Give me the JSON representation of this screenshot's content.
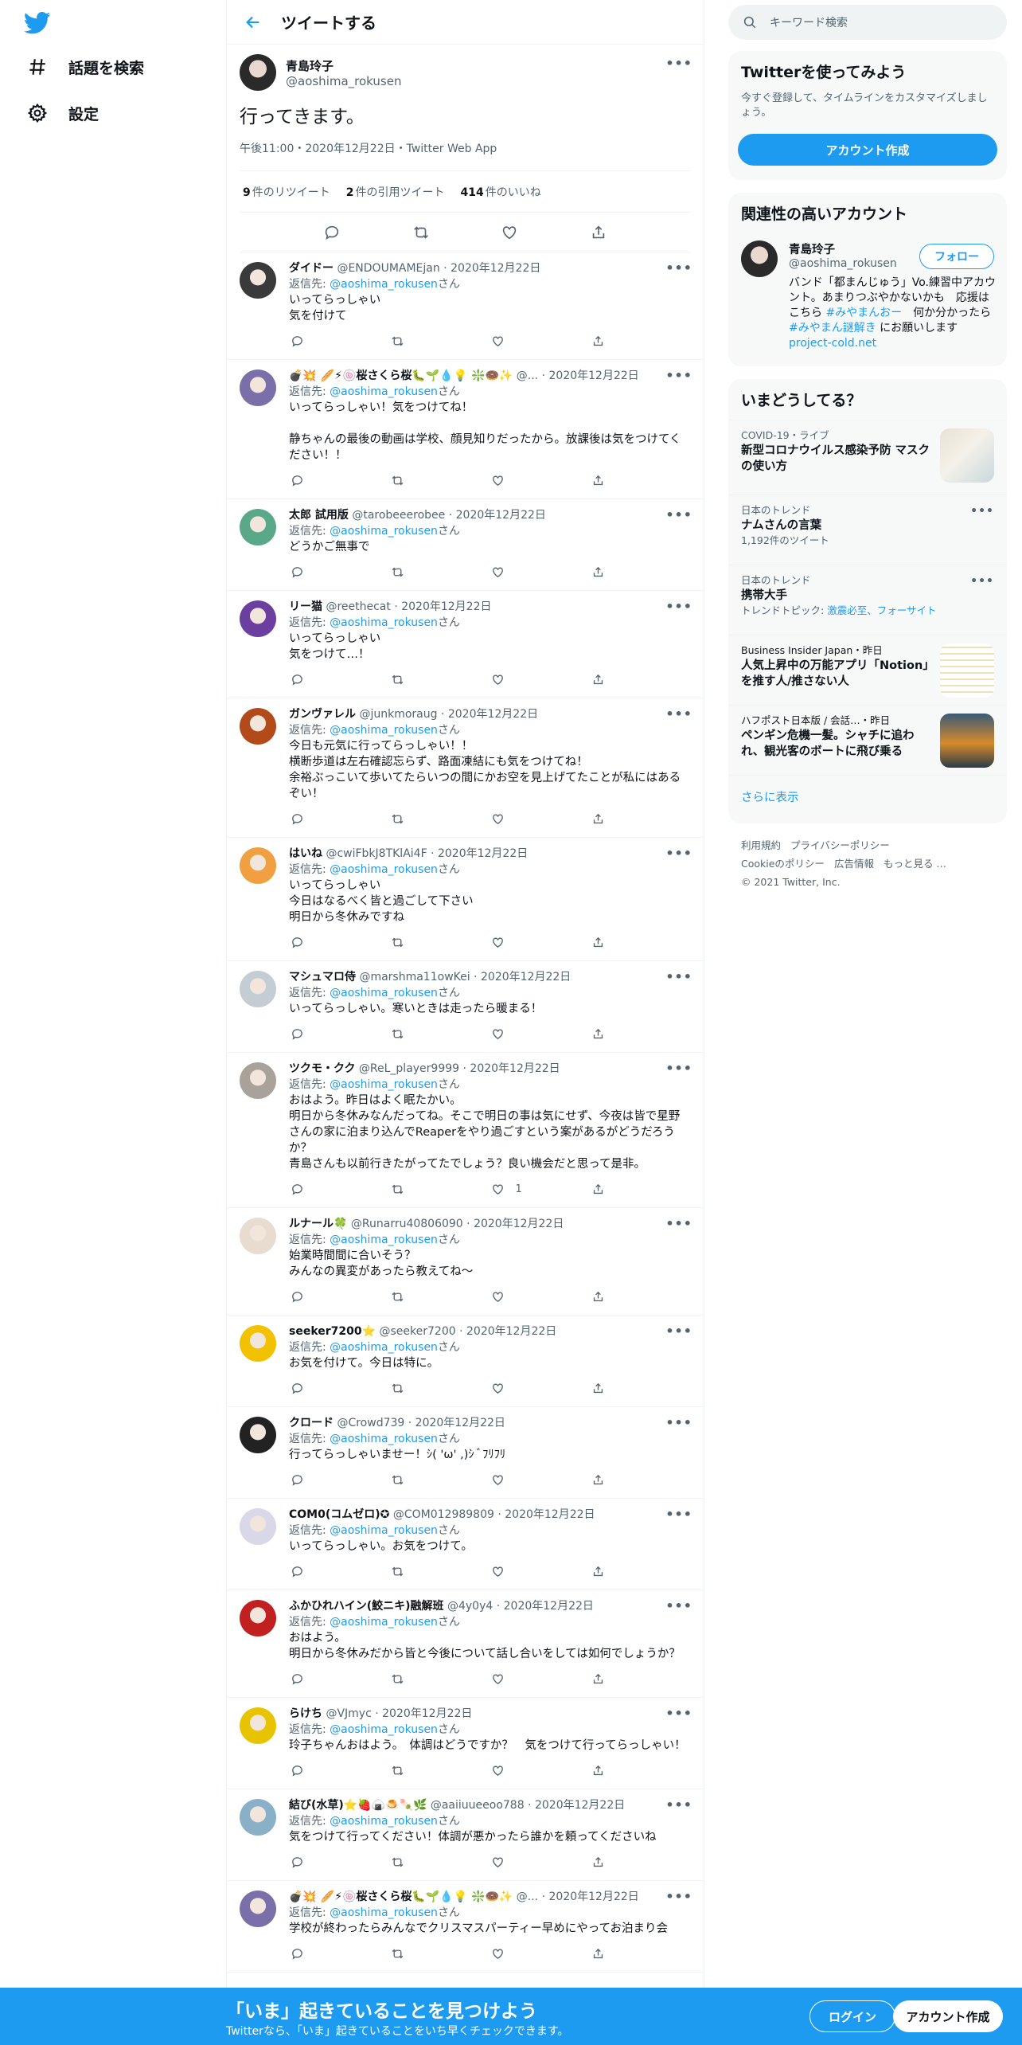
{
  "nav": {
    "items": [
      {
        "label": "話題を検索",
        "icon": "hashtag-icon"
      },
      {
        "label": "設定",
        "icon": "gear-icon"
      }
    ]
  },
  "header": {
    "title": "ツイートする"
  },
  "tweet": {
    "name": "青島玲子",
    "handle": "@aoshima_rokusen",
    "text": "行ってきます。",
    "meta": "午後11:00・2020年12月22日・Twitter Web App",
    "retweets": "9",
    "retweets_label": "件のリツイート",
    "quotes": "2",
    "quotes_label": "件の引用ツイート",
    "likes": "414",
    "likes_label": "件のいいね"
  },
  "reply_prefix": "返信先: ",
  "reply_suffix": "さん",
  "replies": [
    {
      "name": "ダイドー",
      "handle": "@ENDOUMAMEjan",
      "date": "2020年12月22日",
      "to": "@aoshima_rokusen",
      "text": "いってらっしゃい\n気を付けて",
      "likes": "",
      "avatar": "#3a3a3a"
    },
    {
      "name": "💣💥 🥖⚡🍥桜さくら桜🐛🌱💧💡 ❇️🍩✨",
      "handle": "@...",
      "date": "2020年12月22日",
      "to": "@aoshima_rokusen",
      "text": "いってらっしゃい！気をつけてね！\n\n静ちゃんの最後の動画は学校、顔見知りだったから。放課後は気をつけてください！！",
      "likes": "",
      "avatar": "#7a6fa8"
    },
    {
      "name": "太郎 試用版",
      "handle": "@tarobeeerobee",
      "date": "2020年12月22日",
      "to": "@aoshima_rokusen",
      "text": "どうかご無事で",
      "likes": "",
      "avatar": "#5aa88a"
    },
    {
      "name": "リー猫",
      "handle": "@reethecat",
      "date": "2020年12月22日",
      "to": "@aoshima_rokusen",
      "text": "いってらっしゃい\n気をつけて…！",
      "likes": "",
      "avatar": "#6b3fa0"
    },
    {
      "name": "ガンヴァレル",
      "handle": "@junkmoraug",
      "date": "2020年12月22日",
      "to": "@aoshima_rokusen",
      "text": "今日も元気に行ってらっしゃい！！\n横断歩道は左右確認忘らず、路面凍結にも気をつけてね！\n余裕ぶっこいて歩いてたらいつの間にかお空を見上げてたことが私にはあるぞい！",
      "likes": "",
      "avatar": "#b34a1a"
    },
    {
      "name": "はいね",
      "handle": "@cwiFbkJ8TKlAi4F",
      "date": "2020年12月22日",
      "to": "@aoshima_rokusen",
      "text": "いってらっしゃい\n今日はなるべく皆と過ごして下さい\n明日から冬休みですね",
      "likes": "",
      "avatar": "#f0a040"
    },
    {
      "name": "マシュマロ侍",
      "handle": "@marshma11owKei",
      "date": "2020年12月22日",
      "to": "@aoshima_rokusen",
      "text": "いってらっしゃい。寒いときは走ったら暖まる！",
      "likes": "",
      "avatar": "#c4ccd4"
    },
    {
      "name": "ツクモ・クク",
      "handle": "@ReL_player9999",
      "date": "2020年12月22日",
      "to": "@aoshima_rokusen",
      "text": "おはよう。昨日はよく眠たかい。\n明日から冬休みなんだってね。そこで明日の事は気にせず、今夜は皆で星野さんの家に泊まり込んでReaperをやり過ごすという案があるがどうだろうか？\n青島さんも以前行きたがってたでしょう？良い機会だと思って是非。",
      "likes": "1",
      "avatar": "#a8a29a"
    },
    {
      "name": "ルナール🍀",
      "handle": "@Runarru40806090",
      "date": "2020年12月22日",
      "to": "@aoshima_rokusen",
      "text": "始業時間間に合いそう？\nみんなの異変があったら教えてね〜",
      "likes": "",
      "avatar": "#e8dcd0"
    },
    {
      "name": "seeker7200⭐",
      "handle": "@seeker7200",
      "date": "2020年12月22日",
      "to": "@aoshima_rokusen",
      "text": "お気を付けて。今日は特に。",
      "likes": "",
      "avatar": "#f2c200"
    },
    {
      "name": "クロード",
      "handle": "@Crowd739",
      "date": "2020年12月22日",
      "to": "@aoshima_rokusen",
      "text": "行ってらっしゃいませー！ｼ( 'ω' ,)ｼ ﾞﾌﾘﾌﾘ",
      "likes": "",
      "avatar": "#222222"
    },
    {
      "name": "COM0(コムゼロ)✪",
      "handle": "@COM012989809",
      "date": "2020年12月22日",
      "to": "@aoshima_rokusen",
      "text": "いってらっしゃい。お気をつけて。",
      "likes": "",
      "avatar": "#d8d8e8"
    },
    {
      "name": "ふかひれハイン(鮫ニキ)融解班",
      "handle": "@4y0y4",
      "date": "2020年12月22日",
      "to": "@aoshima_rokusen",
      "text": "おはよう。\n明日から冬休みだから皆と今後について話し合いをしては如何でしょうか？",
      "likes": "",
      "avatar": "#c02020"
    },
    {
      "name": "らけち",
      "handle": "@VJmyc",
      "date": "2020年12月22日",
      "to": "@aoshima_rokusen",
      "text": "玲子ちゃんおはよう。　体調はどうですか？　気をつけて行ってらっしゃい！",
      "likes": "",
      "avatar": "#e8c400"
    },
    {
      "name": "結び(水草)⭐🍓🍙🍮🍡🌿",
      "handle": "@aaiiuueeoo788",
      "date": "2020年12月22日",
      "to": "@aoshima_rokusen",
      "text": "気をつけて行ってください！体調が悪かったら誰かを頼ってくださいね",
      "likes": "",
      "avatar": "#8ab0c8"
    },
    {
      "name": "💣💥 🥖⚡🍥桜さくら桜🐛🌱💧💡 ❇️🍩✨",
      "handle": "@...",
      "date": "2020年12月22日",
      "to": "@aoshima_rokusen",
      "text": "学校が終わったらみんなでクリスマスパーティー早めにやってお泊まり会",
      "likes": "",
      "avatar": "#7a6fa8"
    }
  ],
  "search": {
    "placeholder": "キーワード検索"
  },
  "signup_card": {
    "title": "Twitterを使ってみよう",
    "subtitle": "今すぐ登録して、タイムラインをカスタマイズしましょう。",
    "button": "アカウント作成"
  },
  "related": {
    "title": "関連性の高いアカウント",
    "name": "青島玲子",
    "handle": "@aoshima_rokusen",
    "follow": "フォロー",
    "bio_1": "バンド「都まんじゅう」Vo.練習中アカウント。あまりつぶやかないかも　応援はこちら ",
    "bio_tag1": "#みやまんおー",
    "bio_2": "　何か分かったら ",
    "bio_tag2": "#みやまん謎解き",
    "bio_3": " にお願いします　",
    "bio_link": "project-cold.net"
  },
  "trends": {
    "title": "いまどうしてる？",
    "items": [
      {
        "ctx": "COVID-19・ライブ",
        "title": "新型コロナウイルス感染予防 マスクの使い方",
        "sub": ""
      },
      {
        "ctx": "日本のトレンド",
        "title": "ナムさんの言葉",
        "sub": "1,192件のツイート"
      },
      {
        "ctx": "日本のトレンド",
        "title": "携帯大手",
        "sub": "トレンドトピック: ",
        "links": "激震必至、フォーサイト"
      },
      {
        "ctx": "Business Insider Japan・昨日",
        "title": "人気上昇中の万能アプリ「Notion」を推す人/推さない人",
        "sub": ""
      },
      {
        "ctx": "ハフポスト日本版 / 会話…・昨日",
        "title": "ペンギン危機一髪。シャチに追われ、観光客のボートに飛び乗る",
        "sub": ""
      }
    ],
    "show_more": "さらに表示"
  },
  "footer": {
    "l1": "利用規約",
    "l2": "プライバシーポリシー",
    "l3": "Cookieのポリシー",
    "l4": "広告情報",
    "l5": "もっと見る …",
    "copyright": "© 2021 Twitter, Inc."
  },
  "bottom_bar": {
    "title": "「いま」起きていることを見つけよう",
    "subtitle": "Twitterなら、「いま」起きていることをいち早くチェックできます。",
    "login": "ログイン",
    "signup": "アカウント作成"
  },
  "colors": {
    "accent": "#1d9bf0",
    "text": "#0f1419",
    "muted": "#536471"
  }
}
